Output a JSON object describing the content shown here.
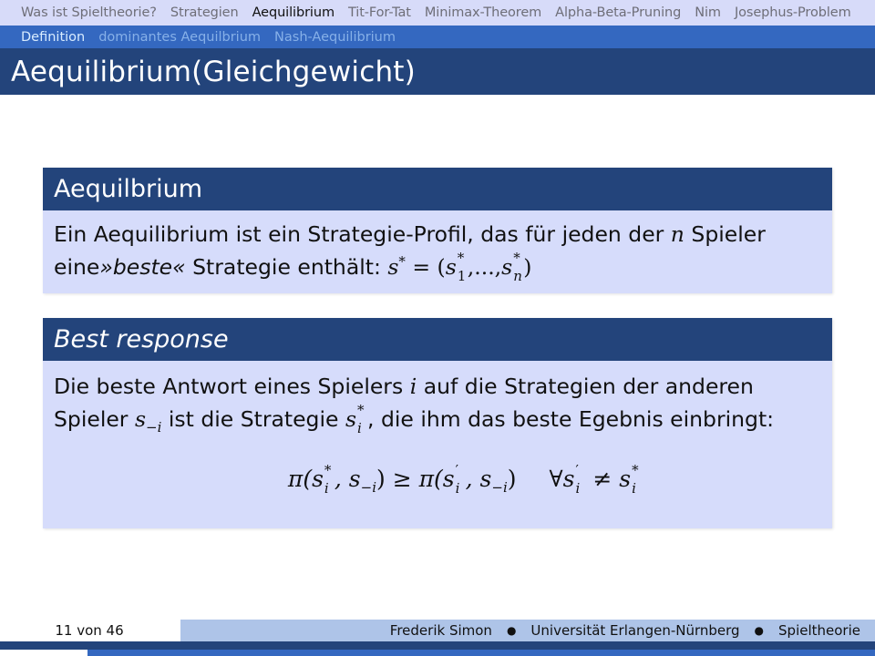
{
  "top_nav": {
    "items": [
      {
        "label": "Was ist Spieltheorie?",
        "active": false
      },
      {
        "label": "Strategien",
        "active": false
      },
      {
        "label": "Aequilibrium",
        "active": true
      },
      {
        "label": "Tit-For-Tat",
        "active": false
      },
      {
        "label": "Minimax-Theorem",
        "active": false
      },
      {
        "label": "Alpha-Beta-Pruning",
        "active": false
      },
      {
        "label": "Nim",
        "active": false
      },
      {
        "label": "Josephus-Problem",
        "active": false
      }
    ]
  },
  "sub_nav": {
    "items": [
      {
        "label": "Definition",
        "active": true
      },
      {
        "label": "dominantes Aequilbrium",
        "active": false
      },
      {
        "label": "Nash-Aequilibrium",
        "active": false
      }
    ]
  },
  "slide": {
    "title": "Aequilibrium(Gleichgewicht)",
    "blocks": [
      {
        "title": "Aequilbrium",
        "line1_a": "Ein Aequilibrium ist ein Strategie-Profil, das für jeden der ",
        "line1_var": "n",
        "line1_b": " Spieler",
        "line2_a": "eine",
        "line2_em": "»beste«",
        "line2_b": " Strategie enthält: ",
        "math_s": "s",
        "math_star": "*",
        "math_eq": " = (",
        "math_s1": "s",
        "math_sub1": "1",
        "math_dots": ",...,",
        "math_sn": "s",
        "math_subn": "n",
        "math_close": ")"
      },
      {
        "title": "Best response",
        "line1_a": "Die beste Antwort eines Spielers ",
        "line1_var": "i",
        "line1_b": " auf die Strategien der anderen",
        "line2_a": "Spieler ",
        "line2_s": "s",
        "line2_sub": "−i",
        "line2_b": " ist die Strategie ",
        "line2_s2": "s",
        "line2_star": "*",
        "line2_sub2": "i",
        "line2_c": ", die ihm das beste Egebnis einbringt:",
        "formula": {
          "lhs": "π(s",
          "lhs_star": "*",
          "lhs_i": "i",
          "lhs_rest": ", s",
          "lhs_sub": "−i",
          "lhs_close": ")",
          "rel": " ≥ ",
          "rhs": "π(s",
          "rhs_prime": "′",
          "rhs_i": "i",
          "rhs_rest": ", s",
          "rhs_sub": "−i",
          "rhs_close": ")",
          "forall": "∀s",
          "forall_prime": "′",
          "forall_i": "i",
          "neq": " ≠ s",
          "neq_star": "*",
          "neq_i": "i"
        }
      }
    ]
  },
  "footer": {
    "page": "11 von 46",
    "author": "Frederik Simon",
    "institution": "Universität Erlangen-Nürnberg",
    "topic": "Spieltheorie",
    "separator": "●"
  }
}
